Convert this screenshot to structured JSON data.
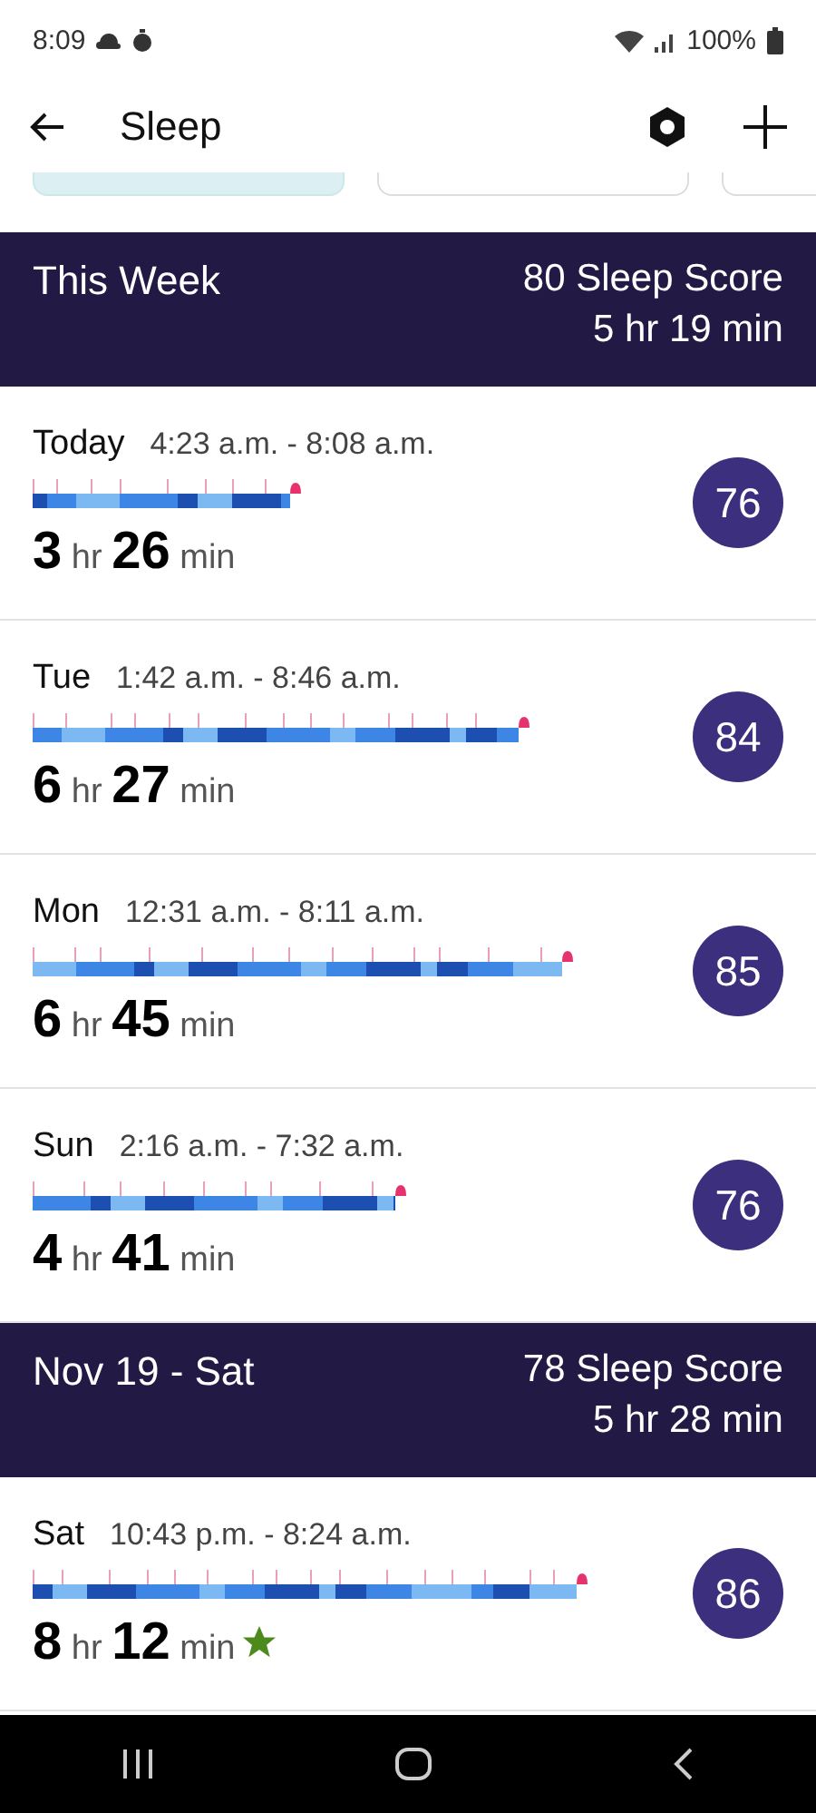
{
  "status_bar": {
    "time": "8:09",
    "battery": "100%"
  },
  "app_bar": {
    "title": "Sleep"
  },
  "groups": [
    {
      "title": "This Week",
      "score": "80 Sleep Score",
      "average": "5 hr 19 min",
      "days": [
        {
          "day": "Today",
          "range": "4:23 a.m. - 8:08 a.m.",
          "duration": "**3** hr **26** min",
          "score": "76",
          "star": false
        },
        {
          "day": "Tue",
          "range": "1:42 a.m. - 8:46 a.m.",
          "duration": "**6** hr **27** min",
          "score": "84",
          "star": false
        },
        {
          "day": "Mon",
          "range": "12:31 a.m. - 8:11 a.m.",
          "duration": "**6** hr **45** min",
          "score": "85",
          "star": false
        },
        {
          "day": "Sun",
          "range": "2:16 a.m. - 7:32 a.m.",
          "duration": "**4** hr **41** min",
          "score": "76",
          "star": false
        }
      ]
    },
    {
      "title": "Nov 19 - Sat",
      "score": "78 Sleep Score",
      "average": "5 hr 28 min",
      "days": [
        {
          "day": "Sat",
          "range": "10:43 p.m. - 8:24 a.m.",
          "duration": "**8** hr **12** min",
          "score": "86",
          "star": true
        }
      ]
    }
  ]
}
